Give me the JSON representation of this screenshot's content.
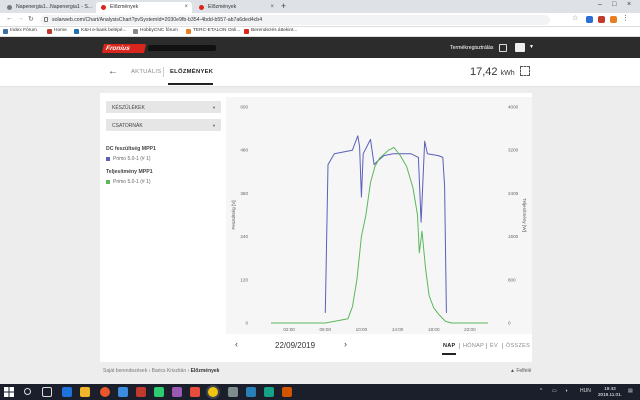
{
  "browser": {
    "tabs": [
      {
        "label": "Napenergia1...Napenergia1 - S..."
      },
      {
        "label": "Előzmények"
      },
      {
        "label": "Előzmények"
      }
    ],
    "new_tab": "+",
    "url": "solarweb.com/Chart/AnalysisChart?pvSystemId=2030e9fb-b354-4bdd-b557-ab7a6ded4cb4",
    "bookmarks": [
      {
        "label": "Index Fórum",
        "color": "#3a6ea5"
      },
      {
        "label": "Home",
        "color": "#c0392b"
      },
      {
        "label": "K&H e-bank belépé...",
        "color": "#1f6fb2"
      },
      {
        "label": "HobbyCNC fórum",
        "color": "#888888"
      },
      {
        "label": "TERC-ETALON Onli...",
        "color": "#e67e22"
      },
      {
        "label": "Berendezés áttekint...",
        "color": "#d9261c"
      }
    ]
  },
  "header": {
    "logo": "Fronius",
    "register_label": "Termékregisztrálás"
  },
  "subnav": {
    "tabs": [
      "AKTUÁLIS",
      "ELŐZMÉNYEK"
    ],
    "total_value": "17,42",
    "total_unit": "kWh"
  },
  "sidebar": {
    "dropdowns": [
      "KÉSZÜLÉKEK",
      "CSATORNÁK"
    ],
    "channels": [
      {
        "title": "DC feszültség MPP1",
        "device": "Primo 5.0-1 (# 1)",
        "color": "#5a5fb8"
      },
      {
        "title": "Teljesítmény MPP1",
        "device": "Primo 5.0-1 (# 1)",
        "color": "#5cb85c"
      }
    ]
  },
  "chart_data": {
    "type": "line",
    "left_axis": {
      "label": "Feszültség [V]",
      "ticks": [
        "0",
        "120",
        "240",
        "360",
        "480",
        "600"
      ],
      "range": [
        0,
        600
      ]
    },
    "right_axis": {
      "label": "Teljesítmény [W]",
      "ticks": [
        "0",
        "800",
        "1600",
        "2400",
        "3200",
        "4000"
      ],
      "range": [
        0,
        4000
      ]
    },
    "x_ticks": [
      "02:00",
      "06:00",
      "10:00",
      "14:00",
      "18:00",
      "22:00"
    ],
    "x_range": [
      0,
      24
    ],
    "grid": false,
    "series": [
      {
        "name": "DC feszültség MPP1",
        "axis": "left",
        "color": "#5a5fb8",
        "points": [
          [
            6.0,
            28
          ],
          [
            6.3,
            440
          ],
          [
            7.0,
            470
          ],
          [
            8.0,
            475
          ],
          [
            9.0,
            480
          ],
          [
            9.6,
            520
          ],
          [
            9.8,
            490
          ],
          [
            10.0,
            350
          ],
          [
            10.2,
            470
          ],
          [
            11.0,
            510
          ],
          [
            11.4,
            440
          ],
          [
            11.8,
            450
          ],
          [
            12.5,
            465
          ],
          [
            13.5,
            470
          ],
          [
            14.5,
            470
          ],
          [
            15.5,
            470
          ],
          [
            16.3,
            460
          ],
          [
            16.6,
            280
          ],
          [
            16.9,
            450
          ],
          [
            17.0,
            505
          ],
          [
            17.3,
            470
          ],
          [
            18.5,
            465
          ],
          [
            19.0,
            460
          ],
          [
            19.2,
            380
          ],
          [
            19.4,
            28
          ]
        ]
      },
      {
        "name": "Teljesítmény MPP1",
        "axis": "right",
        "color": "#5cb85c",
        "points": [
          [
            0,
            0
          ],
          [
            6.0,
            0
          ],
          [
            7.0,
            30
          ],
          [
            8.5,
            80
          ],
          [
            9.0,
            300
          ],
          [
            9.5,
            800
          ],
          [
            10.0,
            1600
          ],
          [
            10.5,
            2000
          ],
          [
            11.0,
            2600
          ],
          [
            11.5,
            2900
          ],
          [
            12.0,
            3050
          ],
          [
            13.0,
            3200
          ],
          [
            13.6,
            3250
          ],
          [
            14.3,
            3100
          ],
          [
            15.0,
            2900
          ],
          [
            15.7,
            2500
          ],
          [
            16.2,
            2000
          ],
          [
            16.4,
            1300
          ],
          [
            16.7,
            1700
          ],
          [
            17.1,
            1000
          ],
          [
            17.5,
            500
          ],
          [
            18.0,
            280
          ],
          [
            18.6,
            150
          ],
          [
            19.3,
            30
          ],
          [
            20.0,
            0
          ],
          [
            24,
            0
          ]
        ]
      }
    ]
  },
  "datenav": {
    "prev": "‹",
    "date": "22/09/2019",
    "next": "›",
    "periods": [
      "NAP",
      "HÓNAP",
      "ÉV",
      "ÖSSZES"
    ]
  },
  "footer": {
    "breadcrumbs": [
      "Saját berendezések",
      "Barics Krisztián",
      "Előzmények"
    ],
    "up_label": "Felfelé"
  },
  "taskbar": {
    "lang": "HUN",
    "time": "19:43",
    "date": "2019.11.01."
  }
}
